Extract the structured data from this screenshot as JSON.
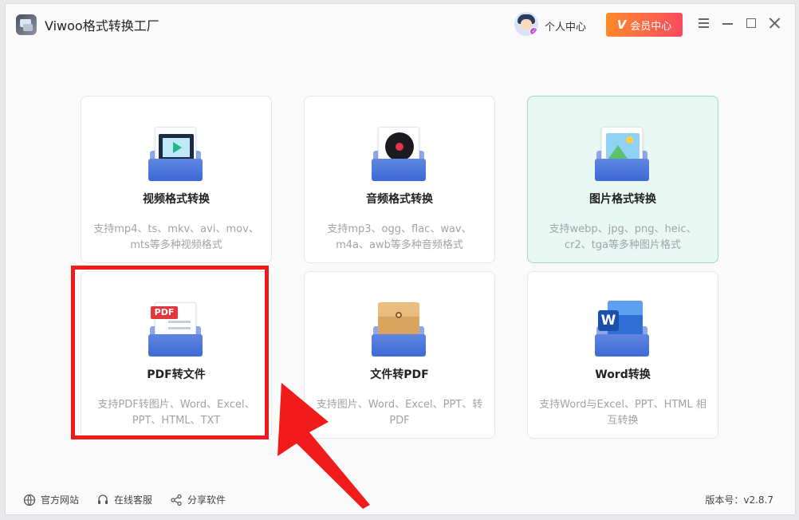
{
  "app": {
    "title": "Viwoo格式转换工厂"
  },
  "header": {
    "user_center": "个人中心",
    "vip_label": "会员中心",
    "vip_mark": "V"
  },
  "cards": [
    {
      "name": "视频格式转换",
      "desc": "支持mp4、ts、mkv、avi、mov、mts等多种视频格式",
      "icon": "video-file-icon"
    },
    {
      "name": "音频格式转换",
      "desc": "支持mp3、ogg、flac、wav、m4a、awb等多种音频格式",
      "icon": "audio-file-icon"
    },
    {
      "name": "图片格式转换",
      "desc": "支持webp、jpg、png、heic、cr2、tga等多种图片格式",
      "icon": "image-file-icon"
    },
    {
      "name": "PDF转文件",
      "desc": "支持PDF转图片、Word、Excel、PPT、HTML、TXT",
      "icon": "pdf-file-icon",
      "badge": "PDF"
    },
    {
      "name": "文件转PDF",
      "desc": "支持图片、Word、Excel、PPT、转PDF",
      "icon": "envelope-file-icon"
    },
    {
      "name": "Word转换",
      "desc": "支持Word与Excel、PPT、HTML 相互转换",
      "icon": "word-file-icon",
      "badge": "W"
    }
  ],
  "footer": {
    "website": "官方网站",
    "support": "在线客服",
    "share": "分享软件",
    "version": "版本号：v2.8.7"
  },
  "colors": {
    "accent_highlight": "#f21b1b",
    "vip_gradient_start": "#ff8a2a",
    "vip_gradient_end": "#f84b5e",
    "active_card_bg": "#e9f8f3"
  }
}
